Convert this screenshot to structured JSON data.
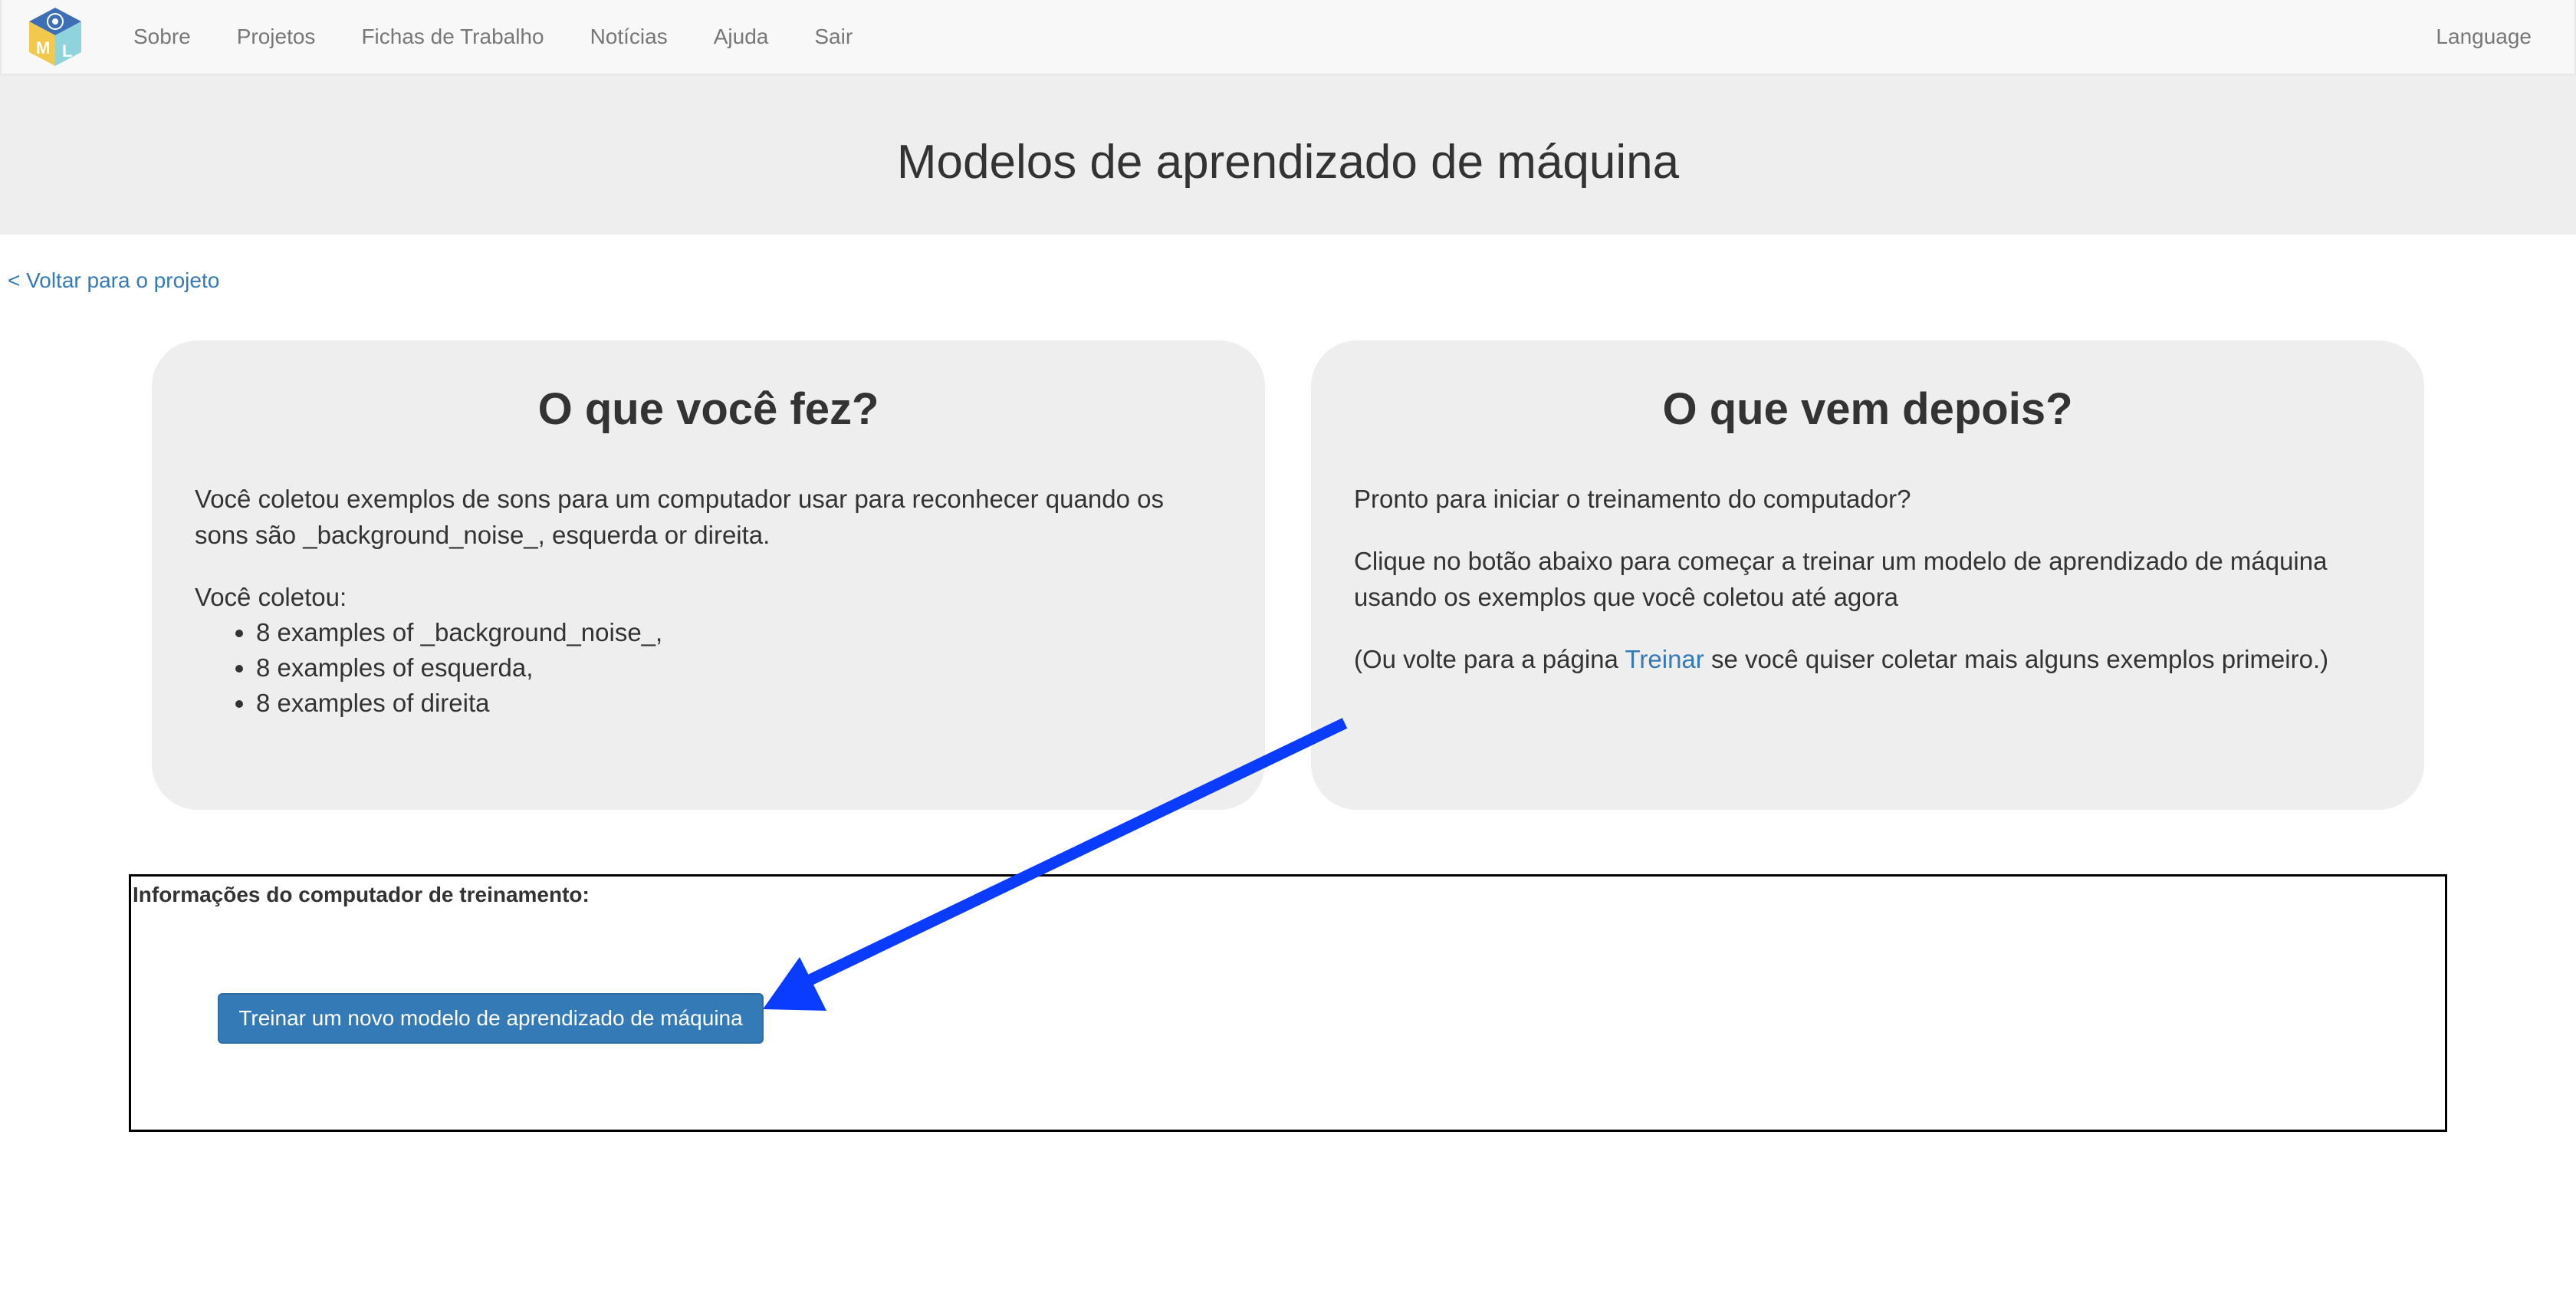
{
  "nav": {
    "items": [
      {
        "label": "Sobre"
      },
      {
        "label": "Projetos"
      },
      {
        "label": "Fichas de Trabalho"
      },
      {
        "label": "Notícias"
      },
      {
        "label": "Ajuda"
      },
      {
        "label": "Sair"
      }
    ],
    "language": "Language"
  },
  "header": {
    "title": "Modelos de aprendizado de máquina"
  },
  "back_link": "< Voltar para o projeto",
  "left_panel": {
    "heading": "O que você fez?",
    "paragraph": "Você coletou exemplos de sons para um computador usar para reconhecer quando os sons são _background_noise_, esquerda or direita.",
    "collected_label": "Você coletou:",
    "items": [
      "8 examples of _background_noise_,",
      "8 examples of esquerda,",
      "8 examples of direita"
    ]
  },
  "right_panel": {
    "heading": "O que vem depois?",
    "p1": "Pronto para iniciar o treinamento do computador?",
    "p2": "Clique no botão abaixo para começar a treinar um modelo de aprendizado de máquina usando os exemplos que você coletou até agora",
    "p3_before": "(Ou volte para a página ",
    "p3_link": "Treinar",
    "p3_after": " se você quiser coletar mais alguns exemplos primeiro.)"
  },
  "training": {
    "label": "Informações do computador de treinamento:",
    "button_label": "Treinar um novo modelo de aprendizado de máquina"
  },
  "colors": {
    "primary": "#337ab7",
    "arrow": "#0a3cff",
    "panel_bg": "#eeeeee",
    "navbar_bg": "#f8f8f8"
  },
  "icons": {
    "logo": "ml-cube-logo-icon",
    "annotation": "arrow-annotation"
  }
}
